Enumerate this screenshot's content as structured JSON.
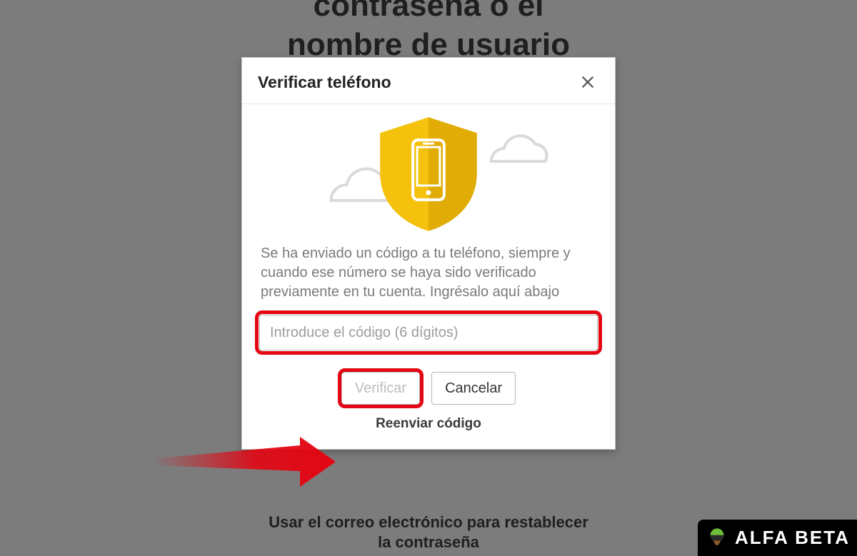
{
  "background": {
    "title_line1": "contraseña o el",
    "title_line2": "nombre de usuario",
    "email_reset_line1": "Usar el correo electrónico para restablecer",
    "email_reset_line2": "la contraseña"
  },
  "modal": {
    "title": "Verificar teléfono",
    "instructions": "Se ha enviado un código a tu teléfono, siempre y cuando ese número se haya sido verificado previamente en tu cuenta. Ingrésalo aquí abajo",
    "code_input_placeholder": "Introduce el código (6 dígitos)",
    "code_input_value": "",
    "verify_label": "Verificar",
    "cancel_label": "Cancelar",
    "resend_label": "Reenviar código"
  },
  "watermark": {
    "text": "ALFA BETA"
  },
  "colors": {
    "annotation_red": "#e30613",
    "shield_yellow": "#f1c40f",
    "shield_yellow_dark": "#d9a404"
  }
}
